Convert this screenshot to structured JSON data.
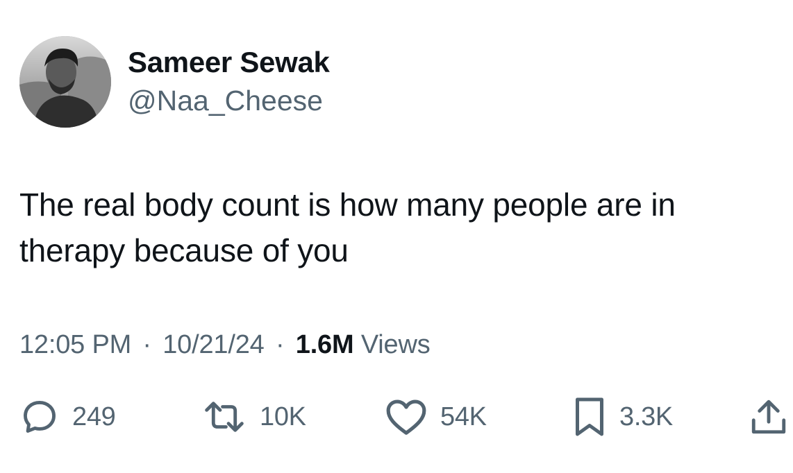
{
  "author": {
    "display_name": "Sameer Sewak",
    "handle": "@Naa_Cheese"
  },
  "tweet": {
    "text": "The real body count is how many people are in therapy because of you"
  },
  "meta": {
    "time": "12:05 PM",
    "separator": "·",
    "date": "10/21/24",
    "views_count": "1.6M",
    "views_label": "Views"
  },
  "actions": {
    "replies": {
      "icon": "reply-icon",
      "count": "249"
    },
    "retweets": {
      "icon": "retweet-icon",
      "count": "10K"
    },
    "likes": {
      "icon": "heart-icon",
      "count": "54K"
    },
    "bookmarks": {
      "icon": "bookmark-icon",
      "count": "3.3K"
    },
    "share": {
      "icon": "share-icon"
    }
  },
  "colors": {
    "text_primary": "#0f1419",
    "text_secondary": "#536471",
    "background": "#ffffff"
  }
}
